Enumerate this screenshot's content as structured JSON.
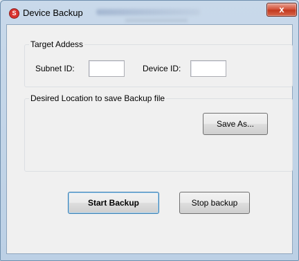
{
  "window": {
    "title": "Device Backup",
    "close_glyph": "x",
    "app_icon_letter": "S"
  },
  "target_group": {
    "title": "Target Addess",
    "subnet_label": "Subnet ID:",
    "subnet_value": "",
    "device_label": "Device ID:",
    "device_value": ""
  },
  "location_group": {
    "title": "Desired Location to save Backup file",
    "save_as_label": "Save As..."
  },
  "actions": {
    "start_label": "Start Backup",
    "stop_label": "Stop backup"
  },
  "colors": {
    "close_button": "#c23a20",
    "app_icon": "#d9332f",
    "default_button_border": "#3c7fb1"
  }
}
